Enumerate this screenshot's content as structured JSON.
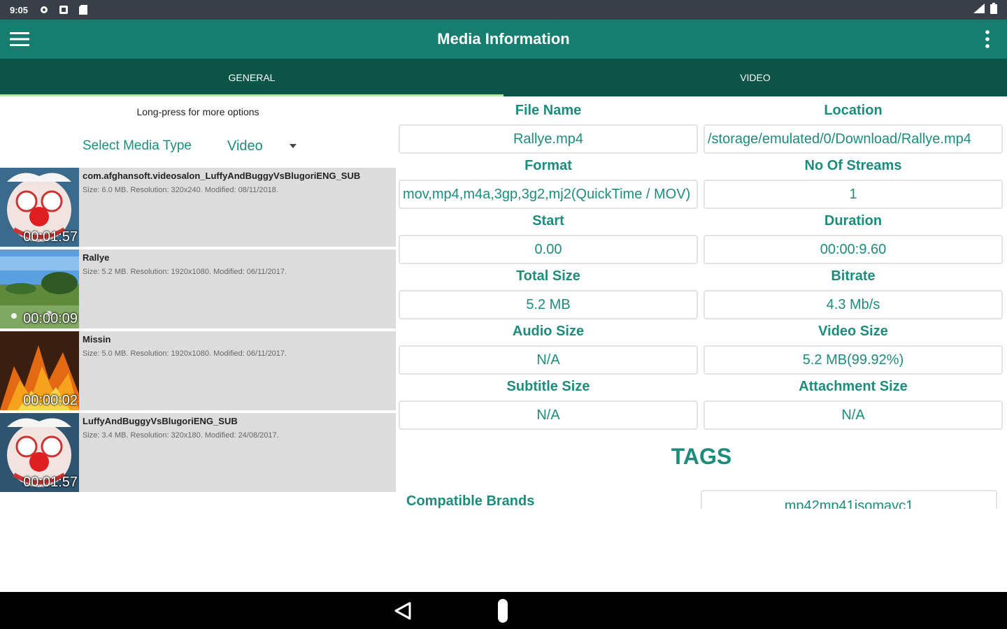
{
  "status": {
    "time": "9:05",
    "icons": [
      "settings-icon",
      "notification-icon",
      "sd-card-icon"
    ],
    "right_icons": [
      "signal-icon",
      "battery-icon"
    ]
  },
  "app": {
    "title": "Media Information",
    "accent": "#167e6f",
    "tab_bar_color": "#0c5448",
    "text_accent": "#1e8c7c"
  },
  "tabs": [
    {
      "label": "GENERAL",
      "active": true
    },
    {
      "label": "VIDEO",
      "active": false
    }
  ],
  "left": {
    "hint": "Long-press for more options",
    "select_label": "Select Media Type",
    "select_value": "Video",
    "items": [
      {
        "name": "com.afghansoft.videosalon_LuffyAndBuggyVsBlugoriENG_SUB",
        "meta": "Size: 6.0 MB. Resolution: 320x240. Modified: 08/11/2018.",
        "duration": "00:01:57",
        "thumb": "clown"
      },
      {
        "name": "Rallye",
        "meta": "Size: 5.2 MB. Resolution: 1920x1080. Modified: 06/11/2017.",
        "duration": "00:00:09",
        "thumb": "landscape"
      },
      {
        "name": "Missin",
        "meta": "Size: 5.0 MB. Resolution: 1920x1080. Modified: 06/11/2017.",
        "duration": "00:00:02",
        "thumb": "fire"
      },
      {
        "name": "LuffyAndBuggyVsBlugoriENG_SUB",
        "meta": "Size: 3.4 MB. Resolution: 320x180. Modified: 24/08/2017.",
        "duration": "00:01:57",
        "thumb": "clown"
      }
    ]
  },
  "fields": [
    {
      "label": "File Name",
      "value": "Rallye.mp4"
    },
    {
      "label": "Location",
      "value": "/storage/emulated/0/Download/Rallye.mp4"
    },
    {
      "label": "Format",
      "value": "mov,mp4,m4a,3gp,3g2,mj2(QuickTime / MOV)"
    },
    {
      "label": "No Of Streams",
      "value": "1"
    },
    {
      "label": "Start",
      "value": "0.00"
    },
    {
      "label": "Duration",
      "value": "00:00:9.60"
    },
    {
      "label": "Total Size",
      "value": "5.2 MB"
    },
    {
      "label": "Bitrate",
      "value": "4.3 Mb/s"
    },
    {
      "label": "Audio Size",
      "value": "N/A"
    },
    {
      "label": "Video Size",
      "value": "5.2 MB(99.92%)"
    },
    {
      "label": "Subtitle Size",
      "value": "N/A"
    },
    {
      "label": "Attachment Size",
      "value": "N/A"
    }
  ],
  "tags": {
    "title": "TAGS",
    "brand_label": "Compatible Brands",
    "brand_value": "mp42mp41isomavc1"
  }
}
